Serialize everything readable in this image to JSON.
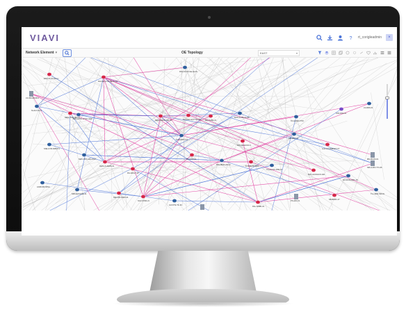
{
  "app": {
    "logo": "VIAVI",
    "user_name": "rt_corigleadmin",
    "user_badge": "×"
  },
  "toolbar": {
    "element_select": "Network Element",
    "view_title": "OE Topology",
    "layout_select": "EAST"
  },
  "topology": {
    "zoom_level": 0.6,
    "node_labels": [
      "EDO-GLL1.OE.LU",
      "RAO-VLOO.GE-HLAS",
      "RAO-ELG.UN.NE.GLAS",
      "LS-INN-ADVAL1",
      "NI-ALO.01-A",
      "NEW-VIVR-NET-A",
      "BRA-LMTK-WYEL.UDP",
      "NWS-GLDNL-RD-02",
      "SV-ALEC.EOY.THAAN",
      "MR-AUNG-01",
      "RUS-GLDE-01-AR",
      "TA-GHRO-OTW",
      "STR-DNG.01",
      "LS-RRS-01",
      "TN-NORTH-01",
      "RAT-DE-EXON-1",
      "PB-ADLY-01",
      "LHA-LALAMBNET-CT",
      "MN-MAUN-01",
      "SNE-GTM-DMINT-1",
      "NWC-DST-ARC-AGX",
      "GHS-LX-AERA-01",
      "RG-ADLLT-SP",
      "RJ-ALNT-01",
      "PAN-MER-LRC-R",
      "R-NNELAD-BRA",
      "TS-ALGSS-HND-01",
      "RVC-ALNCHCO-A01",
      "RV-ALCS-OMC-01",
      "NM-LLDIO-T71-06",
      "ACRN-BLT-BSA",
      "SRD-EUS-RAE-01",
      "PEG-ND-LNDA-01",
      "SGC-STAR-21",
      "ALCOTE-TIL-01",
      "PSL-RCL-04",
      "RAL-SIMBL-01",
      "PS-AZO.01",
      "NB-BRWL-07",
      "TLL-3000-SW-01"
    ]
  },
  "colors": {
    "accent": "#6f5a9e",
    "link_blue": "#4a73d8",
    "link_pink": "#e0309a",
    "link_gray": "#9a9a9a",
    "node_red": "#d6274a",
    "node_blue": "#2f5f9e",
    "node_purple": "#7a4bc8"
  },
  "icons": {
    "search": "search-icon",
    "download": "download-icon",
    "user": "user-icon",
    "help": "help-icon"
  }
}
